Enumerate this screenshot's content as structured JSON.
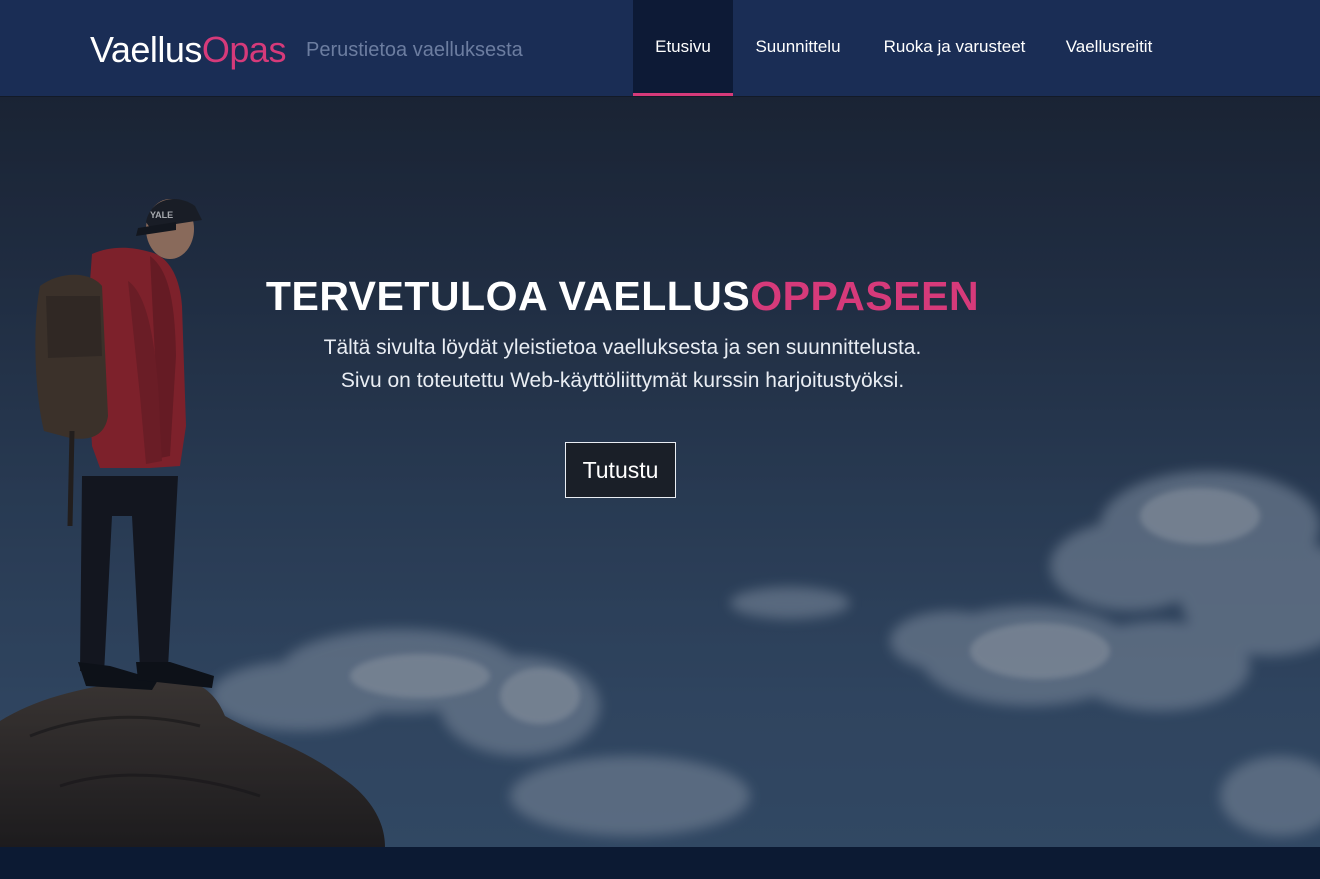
{
  "header": {
    "logo_part1": "Vaellus",
    "logo_part2": "Opas",
    "tagline": "Perustietoa vaelluksesta"
  },
  "nav": {
    "items": [
      {
        "label": "Etusivu",
        "active": true
      },
      {
        "label": "Suunnittelu",
        "active": false
      },
      {
        "label": "Ruoka ja varusteet",
        "active": false
      },
      {
        "label": "Vaellusreitit",
        "active": false
      }
    ]
  },
  "hero": {
    "headline_part1": "TERVETULOA VAELLUS",
    "headline_part2": "OPPASEEN",
    "line1": "Tältä sivulta löydät yleistietoa vaelluksesta ja sen suunnittelusta.",
    "line2": "Sivu on toteutettu Web-käyttöliittymät kurssin harjoitustyöksi.",
    "button_label": "Tutustu",
    "cap_text": "YALE"
  },
  "colors": {
    "header_bg": "#1a2d55",
    "accent": "#d63a7a",
    "active_nav_bg": "#0d1a36",
    "footer_bg": "#0c1a33"
  }
}
